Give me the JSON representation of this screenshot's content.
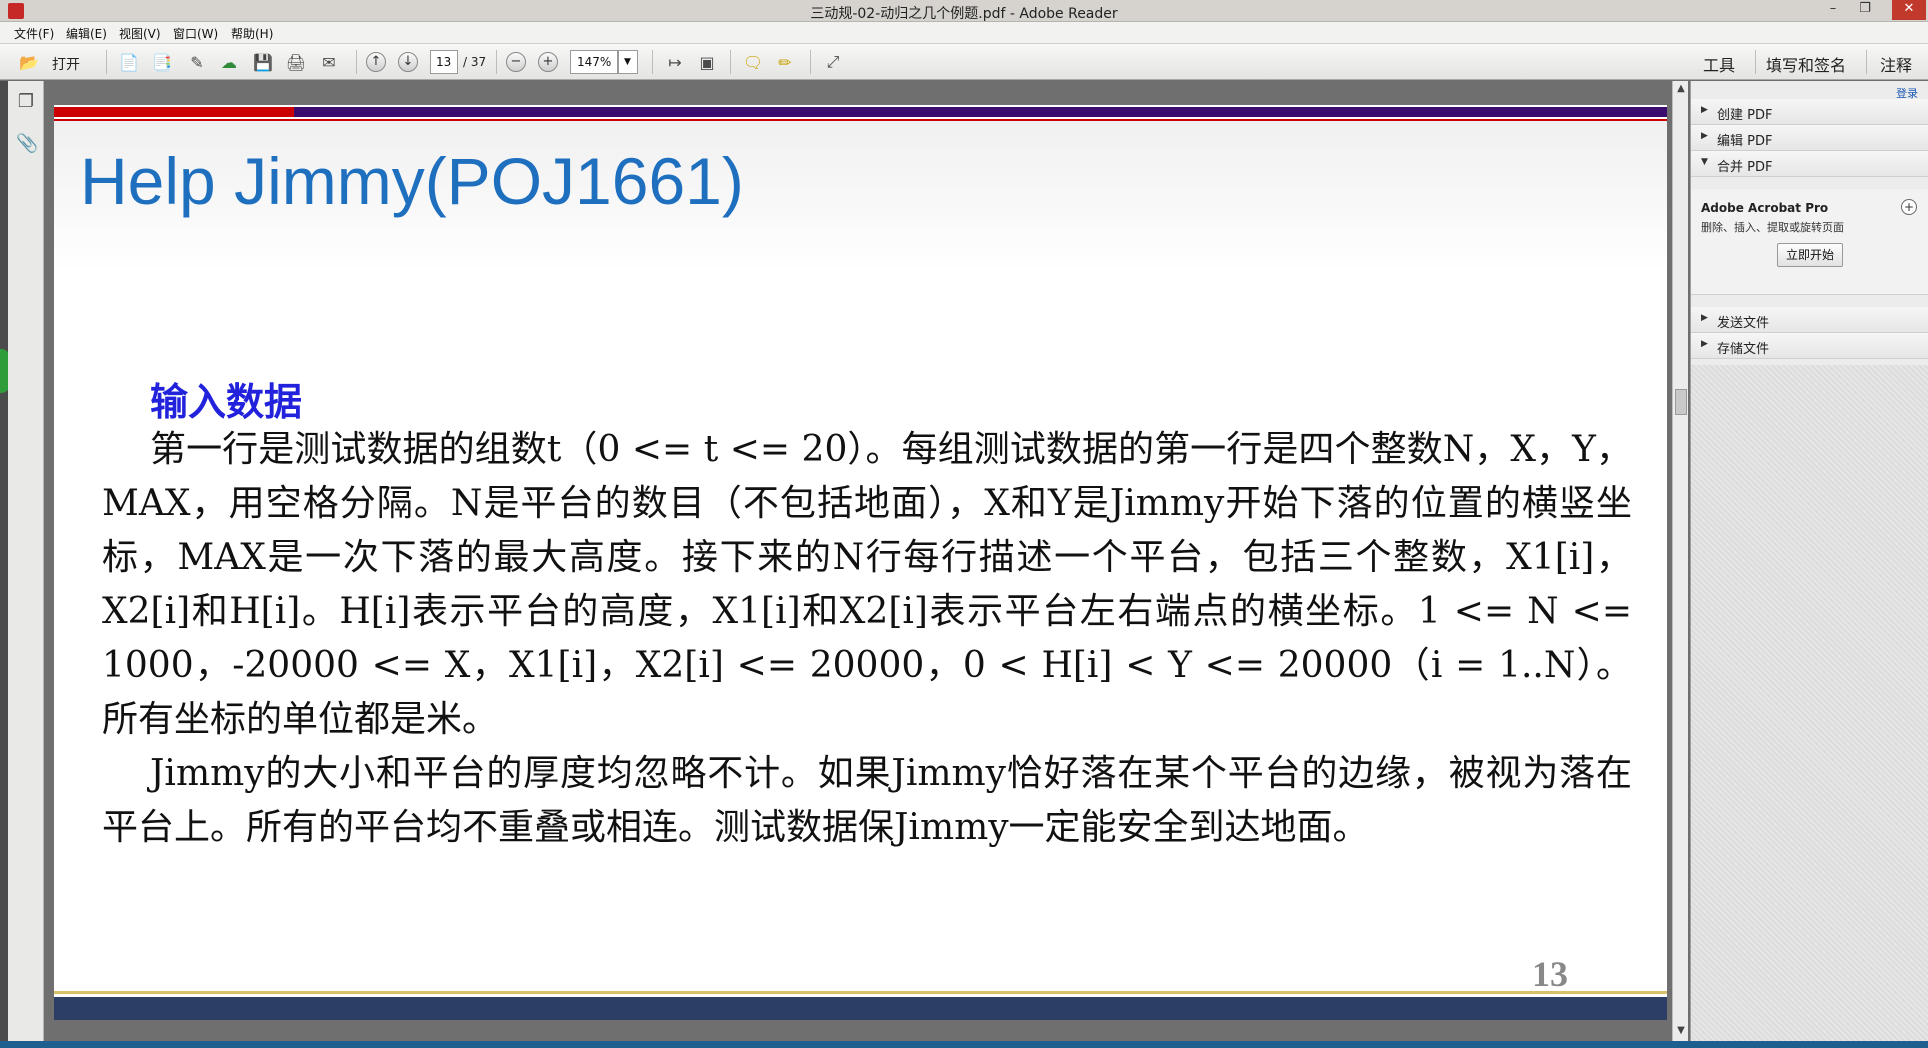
{
  "window": {
    "title": "三动规-02-动归之几个例题.pdf - Adobe Reader",
    "min_glyph": "–",
    "restore_glyph": "❐",
    "close_glyph": "✕"
  },
  "menu": [
    "文件(F)",
    "编辑(E)",
    "视图(V)",
    "窗口(W)",
    "帮助(H)"
  ],
  "toolbar": {
    "open_label": "打开",
    "page_current": "13",
    "page_total": "/ 37",
    "zoom": "147%",
    "tools_label": "工具",
    "sign_label": "填写和签名",
    "comment_label": "注释"
  },
  "slide": {
    "title": "Help Jimmy(POJ1661)",
    "heading": "输入数据",
    "paragraphs": [
      "第一行是测试数据的组数t（0 <= t <= 20）。每组测试数据的第一行是四个整数N，X，Y，MAX，用空格分隔。N是平台的数目（不包括地面），X和Y是Jimmy开始下落的位置的横竖坐标，MAX是一次下落的最大高度。接下来的N行每行描述一个平台，包括三个整数，X1[i]，X2[i]和H[i]。H[i]表示平台的高度，X1[i]和X2[i]表示平台左右端点的横坐标。1 <= N <= 1000，-20000 <= X，X1[i]，X2[i] <= 20000，0 < H[i] < Y <= 20000（i = 1..N）。所有坐标的单位都是米。",
      "Jimmy的大小和平台的厚度均忽略不计。如果Jimmy恰好落在某个平台的边缘，被视为落在平台上。所有的平台均不重叠或相连。测试数据保Jimmy一定能安全到达地面。"
    ],
    "page_number": "13"
  },
  "right_pane": {
    "login": "登录",
    "create_pdf": "创建 PDF",
    "edit_pdf": "编辑 PDF",
    "combine_pdf": "合并 PDF",
    "product": "Adobe Acrobat Pro",
    "product_desc": "删除、插入、提取或旋转页面",
    "start_button": "立即开始",
    "send_files": "发送文件",
    "store_files": "存储文件"
  },
  "colors": {
    "title_blue": "#1f6fbf",
    "heading_blue": "#2222dd",
    "accent_red": "#cc0000",
    "accent_purple": "#3b0b6e",
    "footer_navy": "#2d3e66"
  }
}
